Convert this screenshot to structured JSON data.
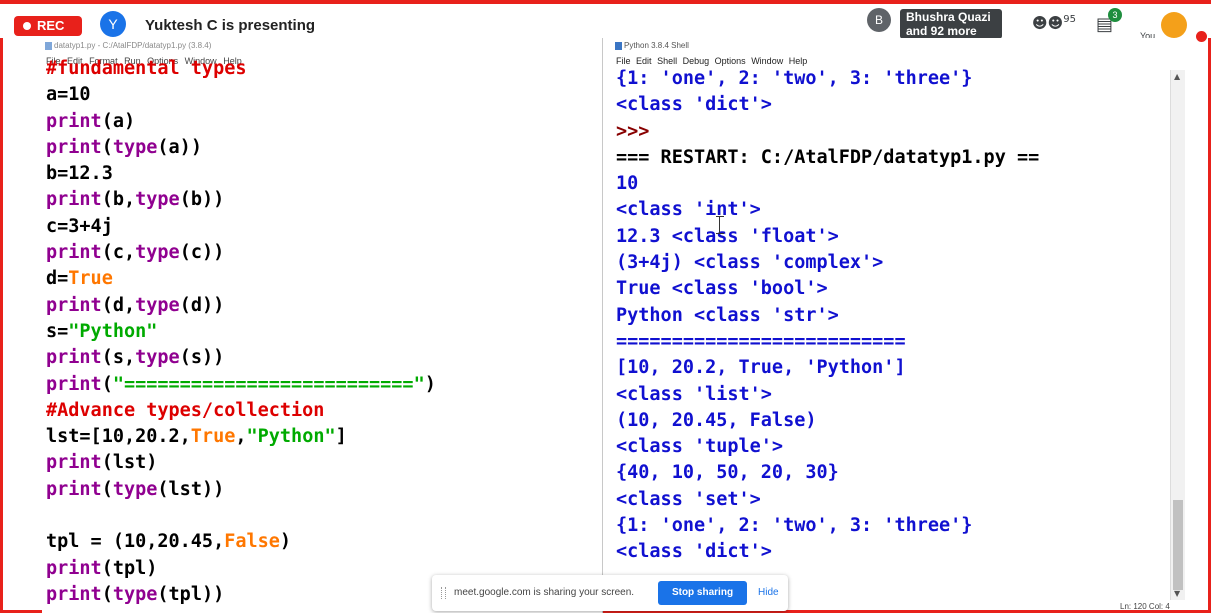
{
  "meet": {
    "rec_label": "REC",
    "presenter_initial": "Y",
    "presenter_text": "Yuktesh C is presenting",
    "participant_initial": "B",
    "participant_text": "Bhushra Quazi and 92 more",
    "people_count": "95",
    "chat_count": "3",
    "you_label": "You",
    "accent_color": "#e8211b"
  },
  "editor": {
    "title": "datatyp1.py - C:/AtalFDP/datatyp1.py (3.8.4)",
    "menu": [
      "File",
      "Edit",
      "Format",
      "Run",
      "Options",
      "Window",
      "Help"
    ]
  },
  "shell": {
    "title": "Python 3.8.4 Shell",
    "menu": [
      "File",
      "Edit",
      "Shell",
      "Debug",
      "Options",
      "Window",
      "Help"
    ],
    "status": "Ln: 120 Col: 4"
  },
  "share_banner": {
    "message": "meet.google.com is sharing your screen.",
    "stop_label": "Stop sharing",
    "hide_label": "Hide"
  }
}
